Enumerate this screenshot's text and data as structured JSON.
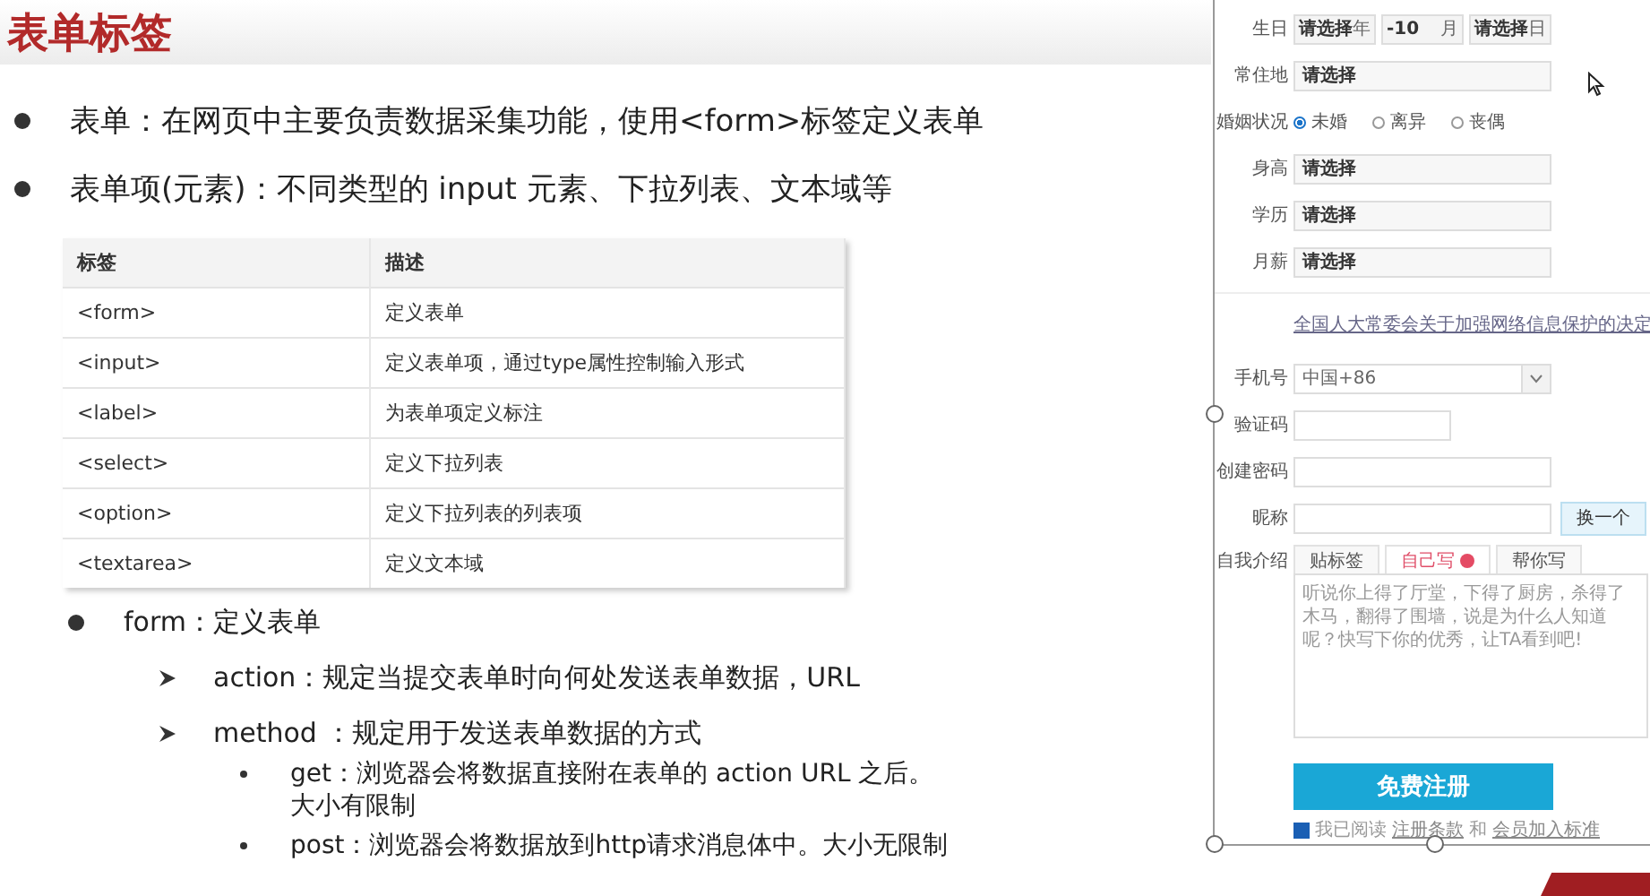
{
  "slide": {
    "title": "表单标签",
    "bullets": [
      "表单：在网页中主要负责数据采集功能，使用<form>标签定义表单",
      "表单项(元素)：不同类型的 input 元素、下拉列表、文本域等"
    ],
    "table": {
      "columns": [
        "标签",
        "描述"
      ],
      "rows": [
        [
          "<form>",
          "定义表单"
        ],
        [
          "<input>",
          "定义表单项，通过type属性控制输入形式"
        ],
        [
          "<label>",
          "为表单项定义标注"
        ],
        [
          "<select>",
          "定义下拉列表"
        ],
        [
          "<option>",
          "定义下拉列表的列表项"
        ],
        [
          "<textarea>",
          "定义文本域"
        ]
      ]
    },
    "detail": {
      "text": "form：定义表单",
      "attributes": [
        {
          "text": "action：规定当提交表单时向何处发送表单数据，URL"
        },
        {
          "text": "method ：规定用于发送表单数据的方式",
          "children": [
            {
              "text": "get：浏览器会将数据直接附在表单的 action URL 之后。大小有限制"
            },
            {
              "text": "post：浏览器会将数据放到http请求消息体中。大小无限制"
            }
          ]
        }
      ]
    }
  },
  "form": {
    "birthday": {
      "label": "生日",
      "selects": [
        {
          "value": "请选择",
          "unit": "年"
        },
        {
          "value": "-10",
          "unit": "月"
        },
        {
          "value": "请选择",
          "unit": "日"
        }
      ]
    },
    "fields": [
      {
        "kind": "select",
        "label": "常住地",
        "value": "请选择"
      },
      {
        "kind": "radio",
        "label": "婚姻状况",
        "options": [
          {
            "label": "未婚",
            "selected": true
          },
          {
            "label": "离异",
            "selected": false
          },
          {
            "label": "丧偶",
            "selected": false
          }
        ]
      },
      {
        "kind": "select",
        "label": "身高",
        "value": "请选择"
      },
      {
        "kind": "select",
        "label": "学历",
        "value": "请选择"
      },
      {
        "kind": "select",
        "label": "月薪",
        "value": "请选择"
      },
      {
        "kind": "link",
        "text": "全国人大常委会关于加强网络信息保护的决定"
      },
      {
        "kind": "phone",
        "label": "手机号",
        "value": "中国+86"
      },
      {
        "kind": "short_input",
        "label": "验证码"
      },
      {
        "kind": "input",
        "label": "创建密码"
      },
      {
        "kind": "input_button",
        "label": "昵称",
        "button": "换一个"
      }
    ],
    "intro": {
      "label": "自我介绍",
      "tabs": [
        {
          "label": "贴标签",
          "selected": false,
          "badge": false
        },
        {
          "label": "自己写",
          "selected": true,
          "badge": true
        },
        {
          "label": "帮你写",
          "selected": false,
          "badge": false
        }
      ],
      "placeholder": "听说你上得了厅堂，下得了厨房，杀得了木马，翻得了围墙，说是为什么人知道呢？快写下你的优秀，让TA看到吧!"
    },
    "submit": "免费注册",
    "agreement": {
      "checked": true,
      "text": "我已阅读",
      "link1": "注册条款",
      "joiner": "和",
      "link2": "会员加入标准"
    }
  }
}
